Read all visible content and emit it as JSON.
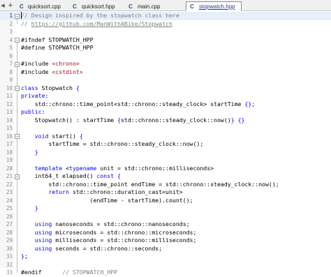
{
  "tabs": [
    {
      "label": "quicksort.cpp",
      "icon": "cpp-file-icon",
      "active": false
    },
    {
      "label": "quicksort.hpp",
      "icon": "hpp-file-icon",
      "active": false
    },
    {
      "label": "main.cpp",
      "icon": "cpp-file-icon",
      "active": false
    },
    {
      "label": "stopwatch.hpp",
      "icon": "hpp-file-icon",
      "active": true
    }
  ],
  "tabbar": {
    "add_symbol": "+",
    "scroll_symbol": "◀"
  },
  "colors": {
    "keyword": "#0000ff",
    "comment": "#808080",
    "string": "#a31515",
    "current_line": "#e8eefb"
  },
  "lines": [
    {
      "n": "1",
      "text": "// Design inspired by the stopwatch class here"
    },
    {
      "n": "2",
      "text": "// https://github.com/ManWithABike/Stopwatch"
    },
    {
      "n": "3",
      "text": ""
    },
    {
      "n": "4",
      "text": "#ifndef STOPWATCH_HPP"
    },
    {
      "n": "5",
      "text": "#define STOPWATCH_HPP"
    },
    {
      "n": "6",
      "text": ""
    },
    {
      "n": "7",
      "text": "#include <chrono>"
    },
    {
      "n": "8",
      "text": "#include <cstdint>"
    },
    {
      "n": "9",
      "text": ""
    },
    {
      "n": "10",
      "text": "class Stopwatch {"
    },
    {
      "n": "11",
      "text": "private:"
    },
    {
      "n": "12",
      "text": "    std::chrono::time_point<std::chrono::steady_clock> startTime {};"
    },
    {
      "n": "13",
      "text": "public:"
    },
    {
      "n": "14",
      "text": "    Stopwatch() : startTime {std::chrono::steady_clock::now()} {}"
    },
    {
      "n": "15",
      "text": ""
    },
    {
      "n": "16",
      "text": "    void start() {"
    },
    {
      "n": "17",
      "text": "        startTime = std::chrono::steady_clock::now();"
    },
    {
      "n": "18",
      "text": "    }"
    },
    {
      "n": "19",
      "text": ""
    },
    {
      "n": "20",
      "text": "    template <typename unit = std::chrono::milliseconds>"
    },
    {
      "n": "21",
      "text": "    int64_t elapsed() const {"
    },
    {
      "n": "22",
      "text": "        std::chrono::time_point endTime = std::chrono::steady_clock::now();"
    },
    {
      "n": "23",
      "text": "        return std::chrono::duration_cast<unit>"
    },
    {
      "n": "24",
      "text": "                    (endTime - startTime).count();"
    },
    {
      "n": "25",
      "text": "    }"
    },
    {
      "n": "26",
      "text": ""
    },
    {
      "n": "27",
      "text": "    using nanoseconds = std::chrono::nanoseconds;"
    },
    {
      "n": "28",
      "text": "    using microseconds = std::chrono::microseconds;"
    },
    {
      "n": "29",
      "text": "    using milliseconds = std::chrono::milliseconds;"
    },
    {
      "n": "30",
      "text": "    using seconds = std::chrono::seconds;"
    },
    {
      "n": "31",
      "text": "};"
    },
    {
      "n": "32",
      "text": ""
    },
    {
      "n": "33",
      "text": "#endif      // STOPWATCH_HPP"
    }
  ]
}
